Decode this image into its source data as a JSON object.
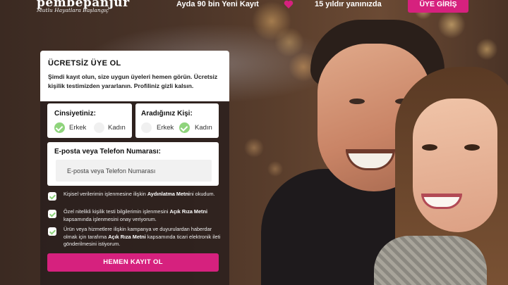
{
  "brand": {
    "logo_text": "pembepanjur",
    "slogan": "Mutlu Hayatlara Başlangıç"
  },
  "topbar": {
    "stat_registrations": "Ayda 90 bin Yeni Kayıt",
    "stat_years": "15 yıldır yanınızda",
    "login_label": "ÜYE GİRİŞ",
    "accent_color": "#d6217e"
  },
  "form": {
    "title": "ÜCRETSİZ ÜYE OL",
    "description": "Şimdi kayıt olun, size uygun üyeleri hemen görün. Ücretsiz kişilik testimizden yararlanın. Profiliniz gizli kalsın.",
    "gender": {
      "label": "Cinsiyetiniz:",
      "options": [
        "Erkek",
        "Kadın"
      ],
      "selected": "Erkek"
    },
    "seeking": {
      "label": "Aradığınız Kişi:",
      "options": [
        "Erkek",
        "Kadın"
      ],
      "selected": "Kadın"
    },
    "contact": {
      "label": "E-posta veya Telefon Numarası:",
      "placeholder": "E-posta veya Telefon Numarası",
      "value": ""
    },
    "consents": [
      {
        "pre": "Kişisel verilerimin işlenmesine ilişkin ",
        "bold": "Aydınlatma Metni",
        "post": "ni okudum."
      },
      {
        "pre": "Özel nitelikli kişilik testi bilgilerimin işlenmesini ",
        "bold": "Açık Rıza Metni",
        "post": " kapsamında işlenmesini onay veriyorum."
      },
      {
        "pre": "Ürün veya hizmetlere ilişkin kampanya ve duyurulardan haberdar olmak için tarafıma ",
        "bold": "Açık Rıza Metni",
        "post": " kapsamında ticari elektronik ileti gönderilmesini istiyorum."
      }
    ],
    "submit_label": "HEMEN KAYIT OL"
  }
}
